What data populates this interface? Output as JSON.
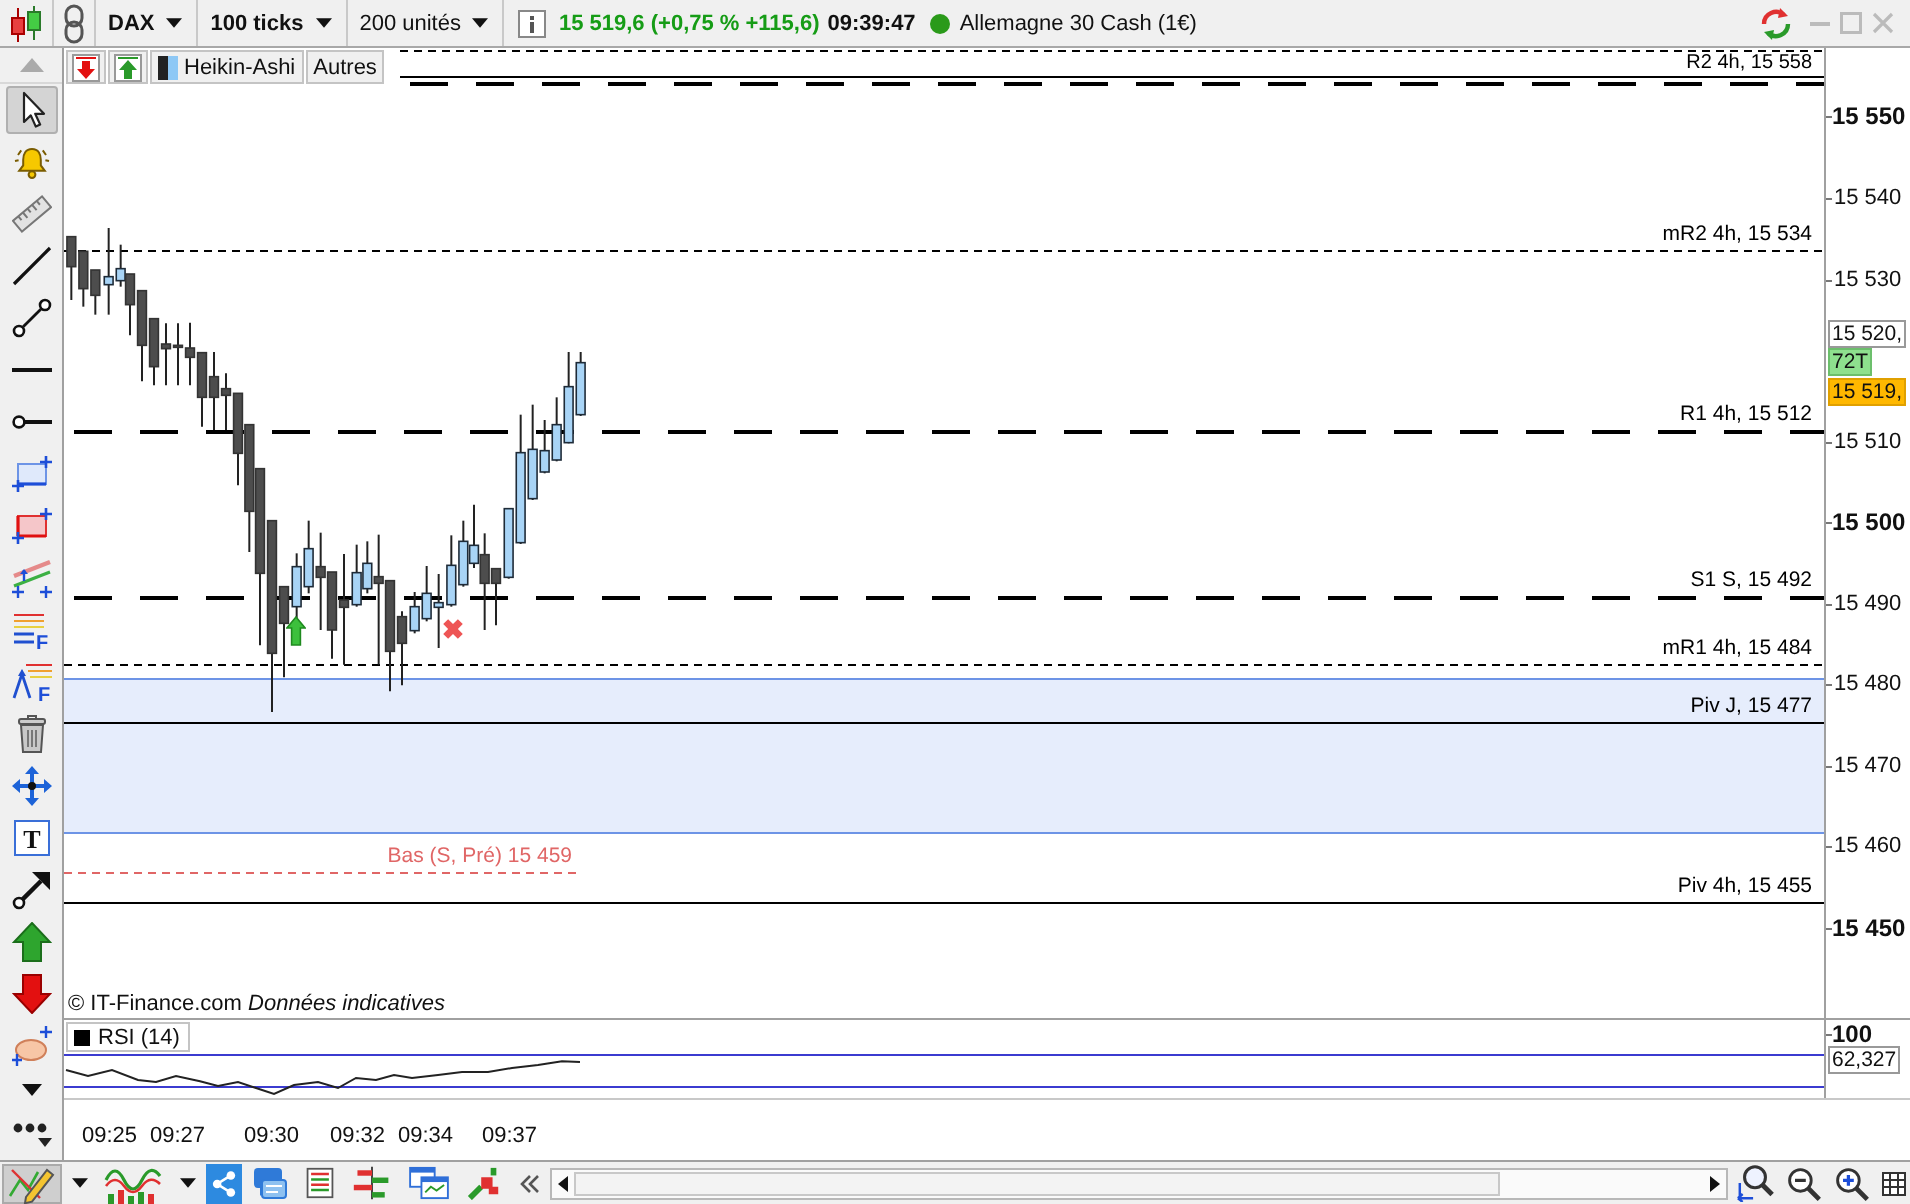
{
  "toolbar": {
    "symbol": "DAX",
    "interval": "100 ticks",
    "units": "200 unités",
    "quote": "15 519,6 (+0,75 % +115,6)",
    "positive": true,
    "time": "09:39:47",
    "instrument": "Allemagne 30 Cash (1€)"
  },
  "chart_buttons": {
    "style": "Heikin-Ashi",
    "more": "Autres"
  },
  "drawing_tools": [
    {
      "selected": true
    },
    {
      "selected": false
    },
    {
      "selected": false
    },
    {
      "selected": false
    },
    {
      "selected": false
    },
    {
      "selected": false
    },
    {
      "selected": false
    },
    {
      "selected": false
    },
    {
      "selected": false
    },
    {
      "selected": false
    },
    {
      "selected": false,
      "glyph": "F"
    },
    {
      "selected": false,
      "glyph": "F"
    },
    {
      "selected": false
    },
    {
      "selected": false
    },
    {
      "selected": false,
      "glyph": "T"
    },
    {
      "selected": false
    },
    {
      "selected": false
    },
    {
      "selected": false
    },
    {
      "selected": false
    },
    {
      "selected": false
    },
    {
      "selected": false
    }
  ],
  "price_chart": {
    "levels": [
      {
        "kind": "short-dash",
        "color": "#000000"
      },
      {
        "kind": "solid",
        "color": "#000000"
      },
      {
        "kind": "long-dash",
        "color": "#000000",
        "label": "R2 4h, 15 558"
      },
      {
        "kind": "short-dash",
        "color": "#000000",
        "label": "mR2 4h, 15 534"
      },
      {
        "kind": "long-dash",
        "color": "#000000",
        "label": "R1 4h, 15 512"
      },
      {
        "kind": "long-dash",
        "color": "#000000",
        "label": "S1 S, 15 492"
      },
      {
        "kind": "short-dash",
        "color": "#000000",
        "label": "mR1 4h, 15 484"
      },
      {
        "kind": "solid",
        "color": "#000000",
        "label": "Piv J, 15 477"
      },
      {
        "kind": "short-dash",
        "color": "#e06666",
        "label": "Bas (S, Pré) 15 459"
      },
      {
        "kind": "solid",
        "color": "#000000",
        "label": "Piv 4h, 15 455"
      }
    ],
    "notice": "© IT-Finance.com *Données indicatives*"
  },
  "price_axis": {
    "ticks": [
      {
        "label": "15 550",
        "kind": "major"
      },
      {
        "label": "15 540",
        "kind": "minor"
      },
      {
        "label": "15 530",
        "kind": "minor"
      },
      {
        "label": "15 510",
        "kind": "minor"
      },
      {
        "label": "15 500",
        "kind": "major"
      },
      {
        "label": "15 490",
        "kind": "minor"
      },
      {
        "label": "15 480",
        "kind": "minor"
      },
      {
        "label": "15 470",
        "kind": "minor"
      },
      {
        "label": "15 460",
        "kind": "minor"
      },
      {
        "label": "15 450",
        "kind": "major"
      }
    ],
    "tags": [
      {
        "kind": "high",
        "label": "15 520,"
      },
      {
        "kind": "count",
        "label": "72T"
      },
      {
        "kind": "last",
        "label": "15 519,"
      }
    ]
  },
  "rsi": {
    "title": "RSI (14)",
    "scale_label": "100",
    "value": "62,327"
  },
  "time_axis": [
    "09:25",
    "09:27",
    "09:30",
    "09:32",
    "09:34",
    "09:37"
  ],
  "bottom_tools": [
    {
      "selected": true
    },
    {
      "selected": false
    },
    {
      "selected": false
    },
    {
      "selected": false
    },
    {
      "selected": true
    },
    {
      "selected": false
    },
    {
      "selected": false
    },
    {
      "selected": false
    },
    {
      "selected": false
    },
    {
      "selected": false
    }
  ]
}
